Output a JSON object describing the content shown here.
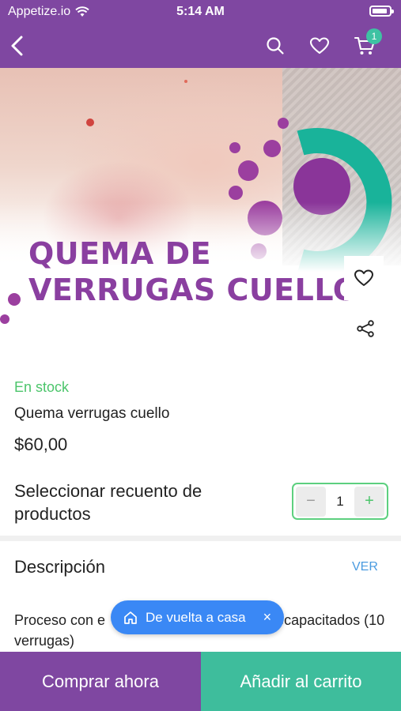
{
  "status_bar": {
    "carrier": "Appetize.io",
    "time": "5:14 AM"
  },
  "nav": {
    "cart_count": "1"
  },
  "hero": {
    "title_line1": "QUEMA DE",
    "title_line2": "VERRUGAS CUELLO"
  },
  "product": {
    "stock": "En stock",
    "name": "Quema verrugas cuello",
    "price": "$60,00"
  },
  "quantity": {
    "label": "Seleccionar recuento de productos",
    "minus": "−",
    "value": "1",
    "plus": "+"
  },
  "description": {
    "title": "Descripción",
    "ver_label": "VER",
    "text_before": "Proceso con e",
    "text_after": "e",
    "text_end": "capacitados (10 verrugas)"
  },
  "toast": {
    "label": "De vuelta a casa",
    "close": "×"
  },
  "actions": {
    "buy_now": "Comprar ahora",
    "add_to_cart": "Añadir al carrito"
  },
  "colors": {
    "brand_purple": "#7f47a1",
    "accent_green": "#3ebd9c",
    "stock_green": "#4cc56b",
    "link_blue": "#4a9be0",
    "toast_blue": "#3a88f5"
  }
}
